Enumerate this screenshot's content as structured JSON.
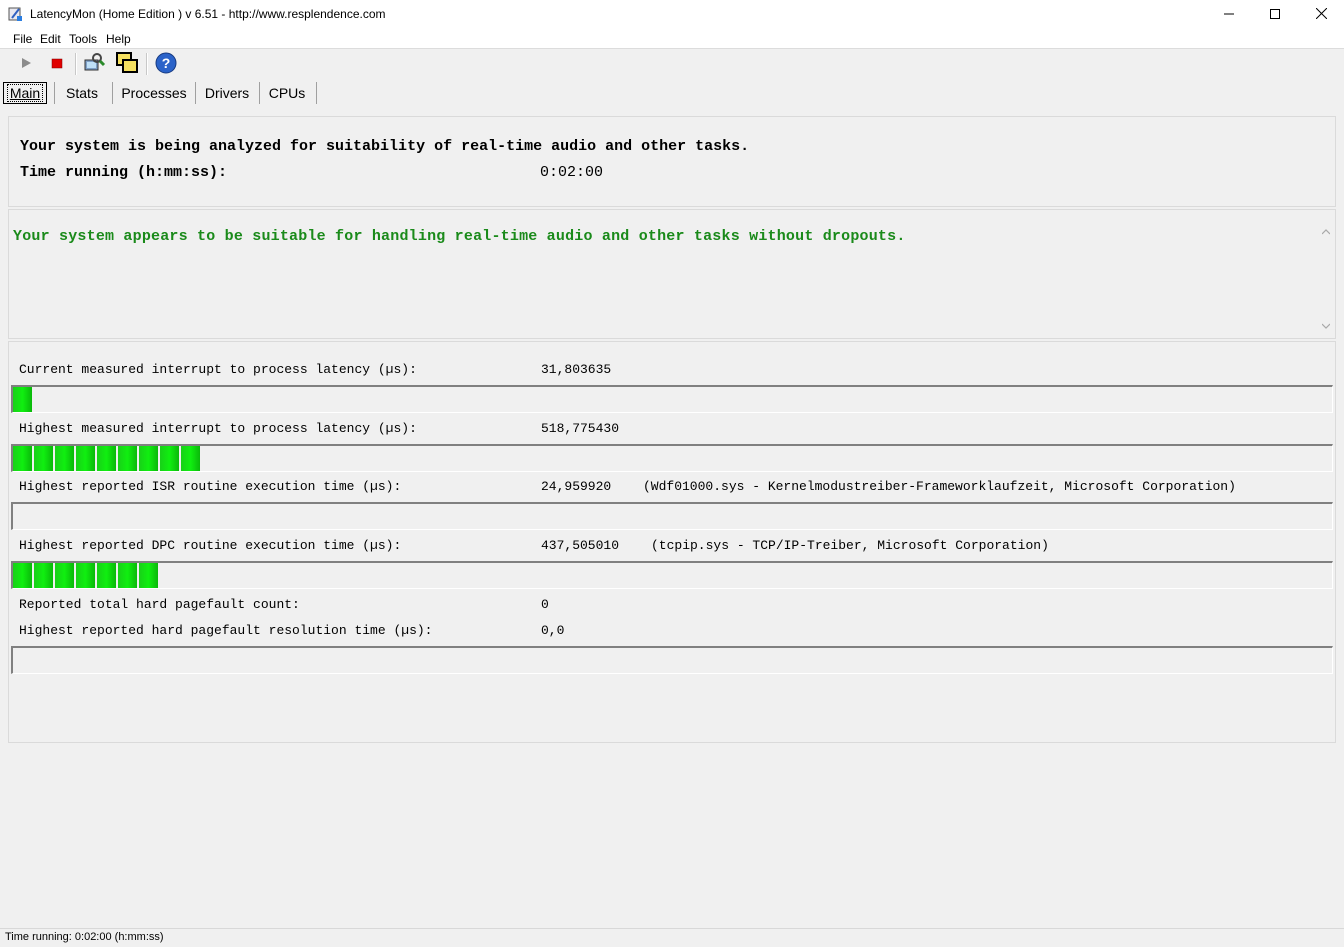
{
  "window": {
    "title": "LatencyMon  (Home Edition )  v 6.51 - http://www.resplendence.com",
    "minimize_glyph": "—",
    "maximize_glyph": "☐",
    "close_glyph": "✕"
  },
  "menu": {
    "file": "File",
    "edit": "Edit",
    "tools": "Tools",
    "help": "Help"
  },
  "toolbar": {
    "icons": [
      "play-icon",
      "stop-icon",
      "driver-check-icon",
      "windows-icon",
      "help-icon"
    ]
  },
  "tabs": {
    "main": "Main",
    "stats": "Stats",
    "processes": "Processes",
    "drivers": "Drivers",
    "cpus": "CPUs"
  },
  "header": {
    "analysis_text": "Your system is being analyzed for suitability of real-time audio and other tasks.",
    "time_label": "Time running (h:mm:ss):",
    "time_value": "0:02:00"
  },
  "verdict": {
    "text": "Your system appears to be suitable for handling real-time audio and other tasks without dropouts.",
    "color": "#1a8a1a"
  },
  "measurements": {
    "current_latency_label": "Current measured interrupt to process latency (µs):",
    "current_latency_value": "31,803635",
    "current_latency_bar_segments": 1,
    "highest_latency_label": "Highest measured interrupt to process latency (µs):",
    "highest_latency_value": "518,775430",
    "highest_latency_bar_segments": 9,
    "isr_label": "Highest reported ISR routine execution time (µs):",
    "isr_value": "24,959920",
    "isr_detail": "(Wdf01000.sys - Kernelmodustreiber-Frameworklaufzeit, Microsoft Corporation)",
    "isr_bar_segments": 0,
    "dpc_label": "Highest reported DPC routine execution time (µs):",
    "dpc_value": "437,505010",
    "dpc_detail": "(tcpip.sys - TCP/IP-Treiber, Microsoft Corporation)",
    "dpc_bar_segments": 7,
    "pagefault_count_label": "Reported total hard pagefault count:",
    "pagefault_count_value": "0",
    "pagefault_time_label": "Highest reported hard pagefault resolution time (µs):",
    "pagefault_time_value": "0,0",
    "pagefault_bar_segments": 0
  },
  "status": {
    "text": "Time running: 0:02:00  (h:mm:ss)"
  }
}
